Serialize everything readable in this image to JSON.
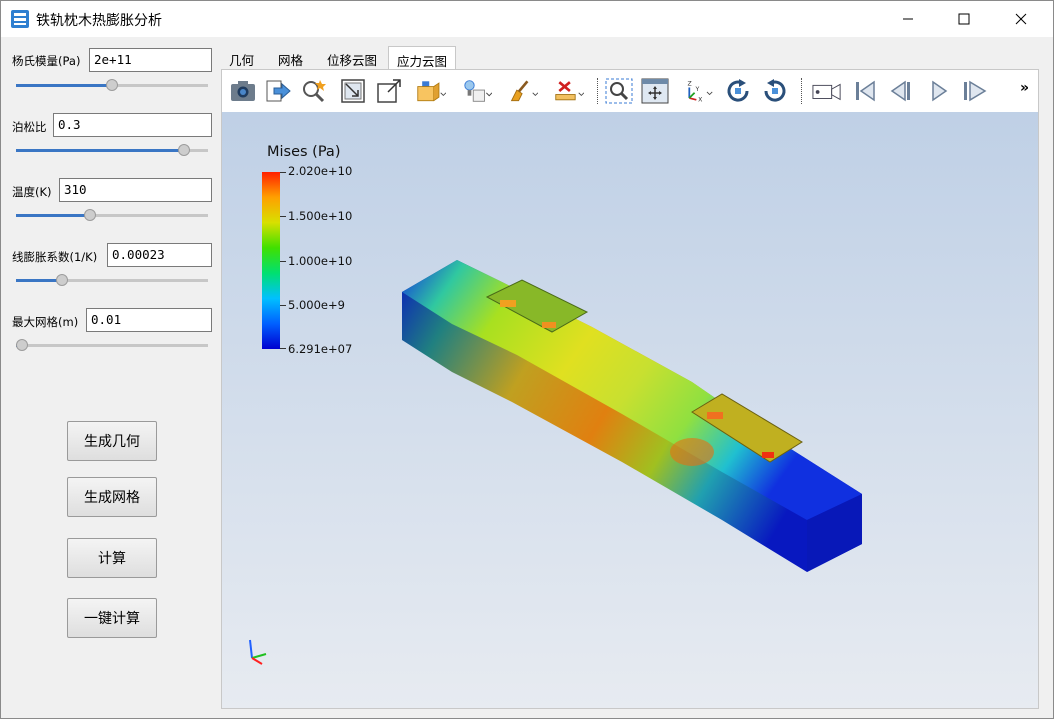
{
  "window": {
    "title": "铁轨枕木热膨胀分析",
    "icon": "app-icon",
    "controls": [
      "minimize-icon",
      "maximize-icon",
      "close-icon"
    ]
  },
  "params": {
    "youngs_modulus": {
      "label": "杨氏模量(Pa)",
      "value": "2e+11",
      "slider": 0.5
    },
    "poisson": {
      "label": "泊松比",
      "value": "0.3",
      "slider": 0.9
    },
    "temperature": {
      "label": "温度(K)",
      "value": "310",
      "slider": 0.38
    },
    "expansion": {
      "label": "线膨胀系数(1/K)",
      "value": "0.00023",
      "slider": 0.22
    },
    "mesh": {
      "label": "最大网格(m)",
      "value": "0.01",
      "slider": 0.0
    }
  },
  "buttons": {
    "geometry": "生成几何",
    "mesh": "生成网格",
    "compute": "计算",
    "one_click": "一键计算"
  },
  "tabs": [
    "几何",
    "网格",
    "位移云图",
    "应力云图"
  ],
  "active_tab": "应力云图",
  "toolbar": {
    "icons": [
      "camera-icon",
      "export-icon",
      "zoom-wand-icon",
      "reset-view-icon",
      "fit-view-icon",
      "box-select-icon",
      "light-icon",
      "cube-view-icon",
      "brush-icon",
      "ruler-clear-icon",
      "zoom-region-icon",
      "pan-fit-icon",
      "axes-orient-icon",
      "rotate-cw-icon",
      "rotate-ccw-icon",
      "camera-record-icon",
      "first-frame-icon",
      "prev-frame-icon",
      "next-frame-icon",
      "last-frame-icon"
    ],
    "more": "»"
  },
  "legend": {
    "title": "Mises (Pa)",
    "ticks": [
      "2.020e+10",
      "1.500e+10",
      "1.000e+10",
      "5.000e+9",
      "6.291e+07"
    ]
  },
  "colors": {
    "accent": "#3a76c4",
    "max": "#ff2000",
    "min": "#0000d0"
  }
}
